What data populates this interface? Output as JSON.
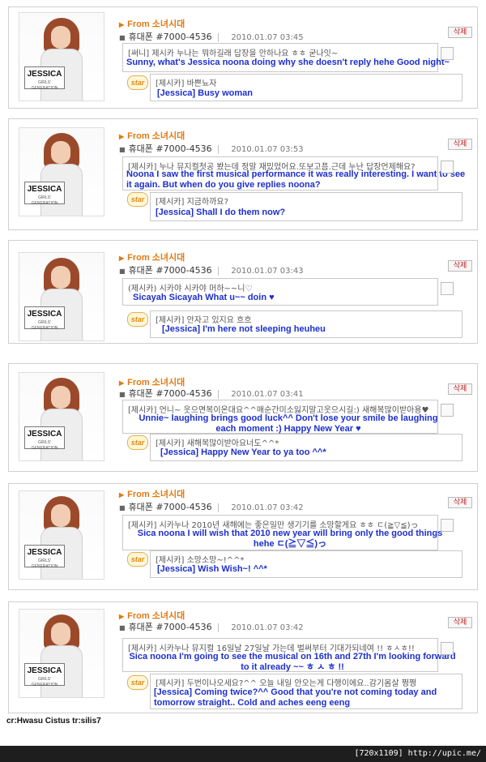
{
  "posts": [
    {
      "from_prefix": "From",
      "from_name": "소녀시대",
      "phone": "휴대폰 #7000-4536",
      "date": "2010.01.07 03:45",
      "delete_label": "삭제",
      "message_kr": "[써니] 제시카 누나는 뭐하길래 답장을 안하나요 ㅎㅎ 굳나잇~",
      "message_en": "Sunny, what's Jessica noona doing why she doesn't reply hehe Good night~",
      "reply_kr": "[제시카] 바쁜뇨자",
      "reply_en": "[Jessica] Busy woman"
    },
    {
      "from_prefix": "From",
      "from_name": "소녀시대",
      "phone": "휴대폰 #7000-4536",
      "date": "2010.01.07 03:53",
      "delete_label": "삭제",
      "message_kr": "[제시카] 누나 뮤지컬첫공 봤는데 정말 재밌었어요.또보고픔.근데 누난 답장언제해요?",
      "message_en": "Noona I saw the first musical performance it was really interesting. I want to see it again. But when do you give replies noona?",
      "reply_kr": "[제시카] 지금하까요?",
      "reply_en": "[Jessica] Shall I do them now?"
    },
    {
      "from_prefix": "From",
      "from_name": "소녀시대",
      "phone": "휴대폰 #7000-4536",
      "date": "2010.01.07 03:43",
      "delete_label": "삭제",
      "message_kr": "(제시카) 시카야 시카야 머하~~니♡",
      "message_en": "Sicayah Sicayah What u~~ doin ♥",
      "reply_kr": "[제시카] 안자고 있지요 흐흐",
      "reply_en": "[Jessica] I'm here not sleeping heuheu"
    },
    {
      "from_prefix": "From",
      "from_name": "소녀시대",
      "phone": "휴대폰 #7000-4536",
      "date": "2010.01.07 03:41",
      "delete_label": "삭제",
      "message_kr": "[제시카] 언니~ 웃으면복이온대요^^매순간미소잃지말고웃으시길:) 새해복많이받아용♥",
      "message_en": "Unnie~ laughing brings good luck^^ Don't lose your smile be laughing each moment :) Happy New Year ♥",
      "reply_kr": "[제시카] 새해복많이받아요너도^^*",
      "reply_en": "[Jessica] Happy New Year to ya too ^^*"
    },
    {
      "from_prefix": "From",
      "from_name": "소녀시대",
      "phone": "휴대폰 #7000-4536",
      "date": "2010.01.07 03:42",
      "delete_label": "삭제",
      "message_kr": "[제시카] 시카누나 2010년 새해에는 좋은일만 생기기를 소망할게요 ㅎㅎ ㄷ(≧▽≦)っ",
      "message_en": "Sica noona I will wish that 2010 new year will bring only the good things hehe ㄷ(≧▽≦)っ",
      "reply_kr": "[제시카] 소망소망~!^^*",
      "reply_en": "[Jessica] Wish Wish~! ^^*"
    },
    {
      "from_prefix": "From",
      "from_name": "소녀시대",
      "phone": "휴대폰 #7000-4536",
      "date": "2010.01.07 03:42",
      "delete_label": "삭제",
      "message_kr": "[제시카] 시카누나 뮤지컬 16일날 27일날 가는데 벌써부터 기대가되네여 !! ㅎㅅㅎ!!",
      "message_en": "Sica noona I'm going to see the musical on 16th and 27th I'm looking forward to it already ~~ ㅎ ㅅ ㅎ !!",
      "reply_kr": "[제시카] 두번이나오세요?^^ 오늘 내일 안오는게 다행이에요..감기몸살 쩡쩡",
      "reply_en": "[Jessica] Coming twice?^^ Good that you're not coming today and tomorrow straight.. Cold and aches eeng eeng"
    }
  ],
  "thumb": {
    "logo": "JESSICA",
    "logo_sub": "GIRLS' GENERATION"
  },
  "star_label": "star",
  "credit": "cr:Hwasu Cistus tr:silis7",
  "footer": "[720x1109] http://upic.me/",
  "colors": {
    "from": "#e07a12",
    "english": "#1d2fcc",
    "delete": "#c02020"
  }
}
